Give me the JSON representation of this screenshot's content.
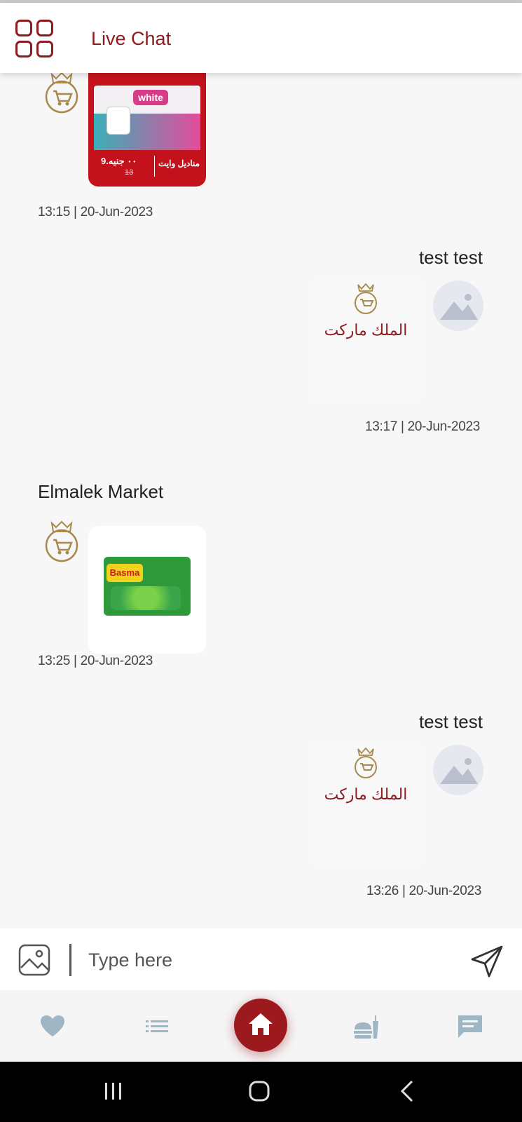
{
  "header": {
    "title": "Live Chat",
    "menu_icon": "grid-icon"
  },
  "messages": [
    {
      "direction": "incoming",
      "sender": "",
      "content_type": "image",
      "image_desc": "product-toilet-paper",
      "overlay_brand": "white",
      "overlay_price": "9.٠٠ جنيه",
      "overlay_old": "13",
      "overlay_title": "مناديل وايت",
      "timestamp": "13:15 | 20-Jun-2023"
    },
    {
      "direction": "outgoing",
      "sender": "test test",
      "content_type": "logo",
      "logo_text": "الملك ماركت",
      "timestamp": "13:17 | 20-Jun-2023"
    },
    {
      "direction": "incoming",
      "sender": "Elmalek Market",
      "content_type": "image",
      "image_desc": "product-frozen-peas",
      "overlay_brand": "Basma",
      "timestamp": "13:25 | 20-Jun-2023"
    },
    {
      "direction": "outgoing",
      "sender": "test test",
      "content_type": "logo",
      "logo_text": "الملك ماركت",
      "timestamp": "13:26 | 20-Jun-2023"
    }
  ],
  "input": {
    "placeholder": "Type here",
    "attach_icon": "image-icon",
    "send_icon": "send-icon"
  },
  "bottom_nav": [
    {
      "name": "favorites",
      "icon": "heart-icon"
    },
    {
      "name": "list",
      "icon": "list-icon"
    },
    {
      "name": "home",
      "icon": "home-icon",
      "active": true
    },
    {
      "name": "menu",
      "icon": "food-icon"
    },
    {
      "name": "chat",
      "icon": "chat-icon"
    }
  ],
  "colors": {
    "brand": "#8c1c1f",
    "home_button": "#9c1a1d",
    "nav_icon": "#9fb7c4",
    "background": "#f7f7f8"
  }
}
